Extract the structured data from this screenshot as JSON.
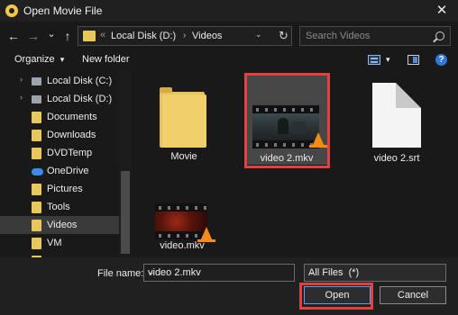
{
  "window": {
    "title": "Open Movie File",
    "close_glyph": "✕"
  },
  "nav": {
    "back_glyph": "←",
    "forward_glyph": "→",
    "recent_glyph": "⌄",
    "up_glyph": "↑",
    "address": {
      "overflow": "«",
      "crumbs": [
        "Local Disk (D:)",
        "Videos"
      ],
      "crumb_sep": "›",
      "dropdown_glyph": "⌄",
      "refresh_glyph": "↻"
    },
    "search_placeholder": "Search Videos"
  },
  "toolbar": {
    "organize_label": "Organize",
    "organize_arrow": "▾",
    "new_folder_label": "New folder",
    "view_arrow": "▾"
  },
  "sidebar": {
    "items": [
      {
        "label": "Local Disk (C:)",
        "icon": "drive-icon"
      },
      {
        "label": "Local Disk (D:)",
        "icon": "drive-icon"
      },
      {
        "label": "Documents",
        "icon": "folder-icon"
      },
      {
        "label": "Downloads",
        "icon": "folder-icon"
      },
      {
        "label": "DVDTemp",
        "icon": "folder-icon"
      },
      {
        "label": "OneDrive",
        "icon": "cloud-icon"
      },
      {
        "label": "Pictures",
        "icon": "folder-icon"
      },
      {
        "label": "Tools",
        "icon": "folder-icon"
      },
      {
        "label": "Videos",
        "icon": "folder-icon",
        "selected": true
      },
      {
        "label": "VM",
        "icon": "folder-icon"
      }
    ],
    "chevron_glyph": "›"
  },
  "files": [
    {
      "name": "Movie",
      "type": "folder"
    },
    {
      "name": "video 2.mkv",
      "type": "video",
      "selected": true
    },
    {
      "name": "video 2.srt",
      "type": "document"
    },
    {
      "name": "video.mkv",
      "type": "video"
    }
  ],
  "footer": {
    "file_name_label": "File name:",
    "file_name_value": "video 2.mkv",
    "file_type_value": "All Files  (*)",
    "dropdown_glyph": "⌄",
    "open_label": "Open",
    "cancel_label": "Cancel"
  },
  "colors": {
    "folder": "#e8c85a",
    "highlight": "#e34040",
    "vlc_cone": "#f28c17"
  }
}
